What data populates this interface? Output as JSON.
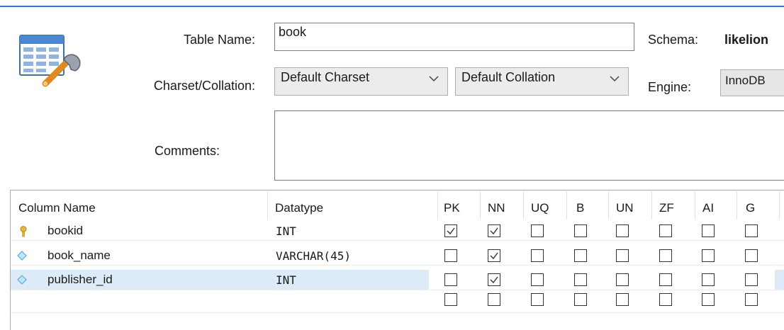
{
  "table_name_label": "Table Name:",
  "table_name_value": "book",
  "schema_label": "Schema:",
  "schema_value": "likelion",
  "charset_label": "Charset/Collation:",
  "charset_value": "Default Charset",
  "collation_value": "Default Collation",
  "engine_label": "Engine:",
  "engine_value": "InnoDB",
  "comments_label": "Comments:",
  "comments_value": "",
  "icons": {
    "table": "table-wrench-icon",
    "primary_key": "key-icon",
    "column": "diamond-icon",
    "dropdown": "chevron-down-icon",
    "check": "checkmark-icon"
  },
  "colors": {
    "accent_line": "#2b78e4",
    "selected_row": "#ddeaf8",
    "key": "#e8b830",
    "diamond": "#6fc4e6"
  },
  "grid": {
    "headers": {
      "column_name": "Column Name",
      "datatype": "Datatype",
      "flags": [
        "PK",
        "NN",
        "UQ",
        "B",
        "UN",
        "ZF",
        "AI",
        "G"
      ]
    },
    "rows": [
      {
        "name": "bookid",
        "datatype": "INT",
        "icon": "key-icon",
        "flags": [
          true,
          true,
          false,
          false,
          false,
          false,
          false,
          false
        ]
      },
      {
        "name": "book_name",
        "datatype": "VARCHAR(45)",
        "icon": "diamond-icon",
        "flags": [
          false,
          true,
          false,
          false,
          false,
          false,
          false,
          false
        ]
      },
      {
        "name": "publisher_id",
        "datatype": "INT",
        "icon": "diamond-icon",
        "selected": true,
        "flags": [
          false,
          true,
          false,
          false,
          false,
          false,
          false,
          false
        ]
      },
      {
        "name": "",
        "datatype": "",
        "icon": "",
        "flags": [
          false,
          false,
          false,
          false,
          false,
          false,
          false,
          false
        ]
      }
    ]
  }
}
